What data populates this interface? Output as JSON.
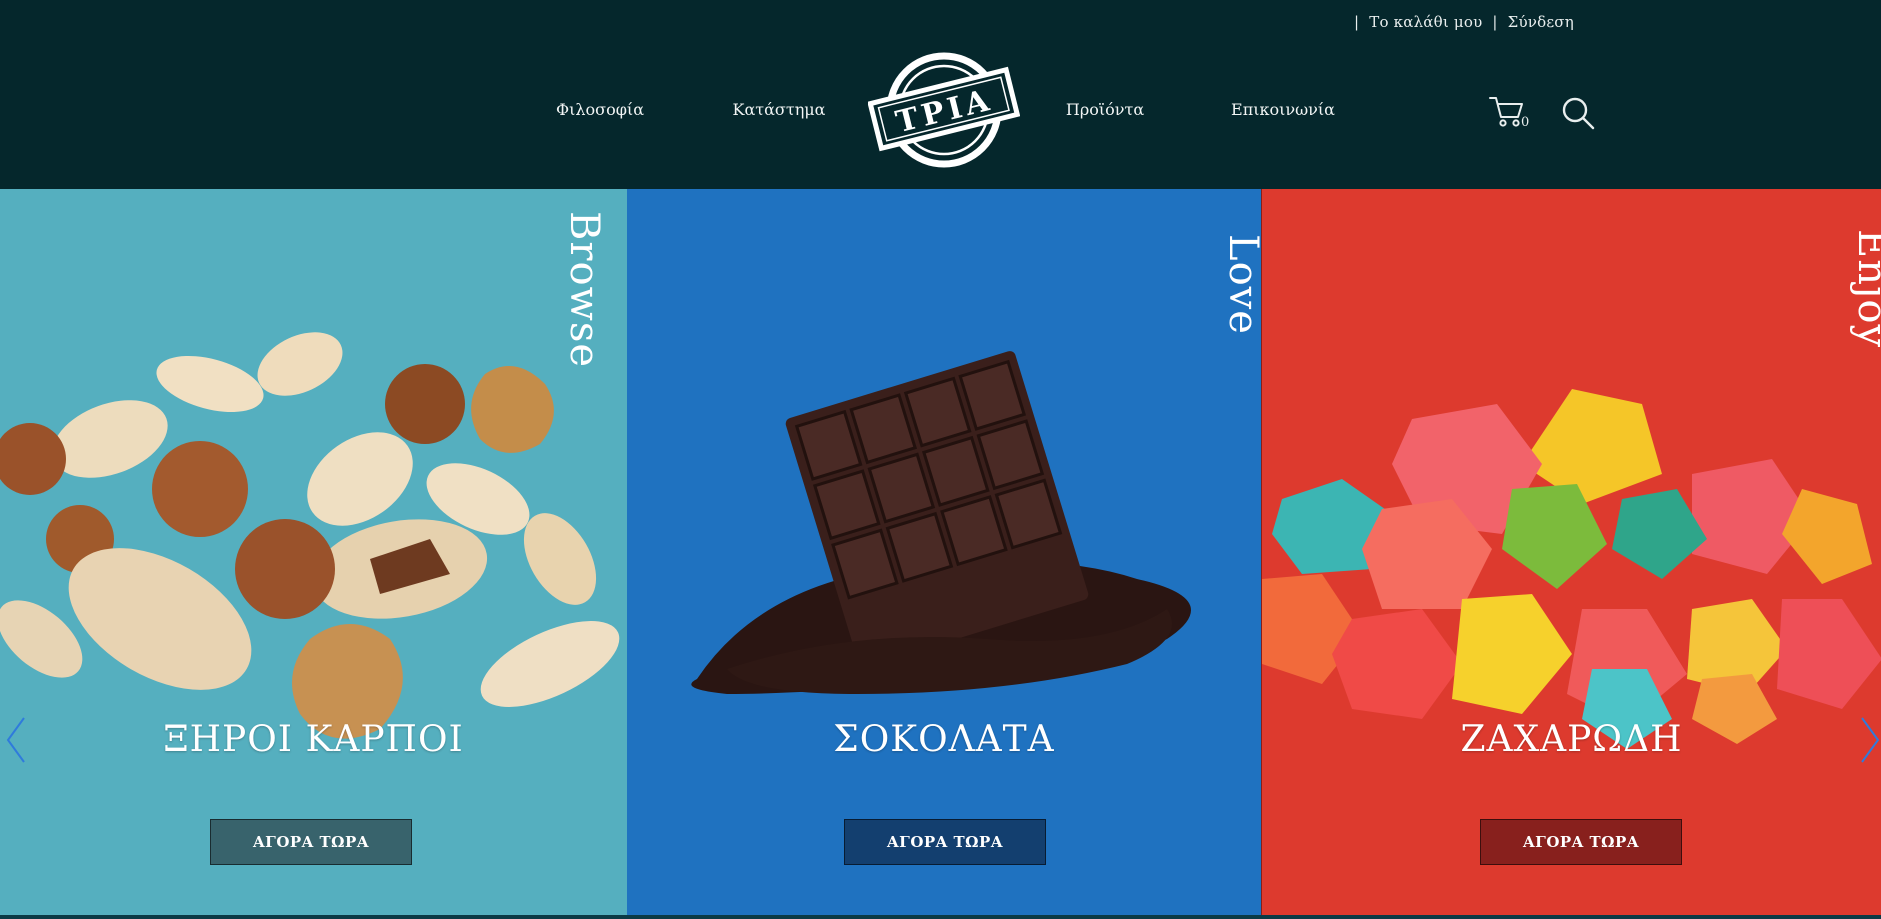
{
  "topbar": {
    "cart_link": "Το καλάθι μου",
    "login_link": "Σύνδεση",
    "separator": "|"
  },
  "nav": {
    "philosophy": "Φιλοσοφία",
    "store": "Κατάστημα",
    "products": "Προϊόντα",
    "contact": "Επικοινωνία"
  },
  "logo": {
    "text": "ΤΡΙΑ"
  },
  "cart": {
    "count": "0",
    "icon": "cart-icon"
  },
  "search": {
    "icon": "search-icon"
  },
  "panels": [
    {
      "word": "Browse",
      "title": "ΞΗΡΟΙ ΚΑΡΠΟΙ",
      "button": "ΑΓΟΡΑ ΤΩΡΑ",
      "bg": "#55afbf",
      "button_bg": "#38636c"
    },
    {
      "word": "Love",
      "title": "ΣΟΚΟΛΑΤΑ",
      "button": "ΑΓΟΡΑ ΤΩΡΑ",
      "bg": "#1f72c0",
      "button_bg": "#133f6f"
    },
    {
      "word": "Enjoy",
      "title": "ΖΑΧΑΡΩΔΗ",
      "button": "ΑΓΟΡΑ ΤΩΡΑ",
      "bg": "#dd3a2e",
      "button_bg": "#88201d"
    }
  ],
  "colors": {
    "header_bg": "#05272c",
    "text": "#ffffff"
  }
}
